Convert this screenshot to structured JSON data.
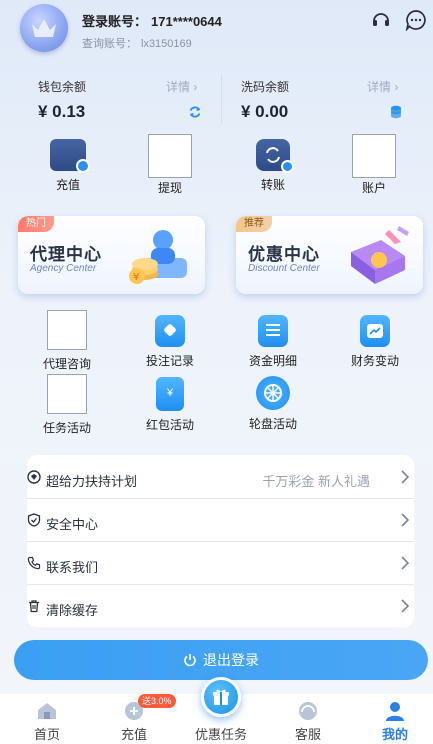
{
  "header": {
    "account_label": "登录账号：",
    "account_value": "171****0644",
    "query_label": "查询账号：",
    "query_value": "lx3150169",
    "icons": [
      "headset-icon",
      "chat-icon"
    ]
  },
  "wallet": {
    "balance_label": "钱包余额",
    "balance_detail": "详情",
    "balance_value": "¥ 0.13",
    "wash_label": "洗码余额",
    "wash_detail": "详情",
    "wash_value": "¥ 0.00"
  },
  "actions": {
    "deposit": "充值",
    "withdraw": "提现",
    "transfer": "转账",
    "account": "账户"
  },
  "banners": {
    "agency": {
      "tag": "热门",
      "title": "代理中心",
      "subtitle": "Agency Center"
    },
    "discount": {
      "tag": "推荐",
      "title": "优惠中心",
      "subtitle": "Discount Center"
    }
  },
  "features": {
    "agent_consult": "代理咨询",
    "bet_record": "投注记录",
    "fund_detail": "资金明细",
    "finance_change": "财务变动",
    "task_activity": "任务活动",
    "red_packet": "红包活动",
    "wheel": "轮盘活动"
  },
  "menu": {
    "support_plan": "超给力扶持计划",
    "support_extra": "千万彩金 新人礼遇",
    "security": "安全中心",
    "contact": "联系我们",
    "clear_cache": "清除缓存"
  },
  "logout_label": "退出登录",
  "tabbar": {
    "home": "首页",
    "recharge": "充值",
    "recharge_badge": "送3.0%",
    "promo": "优惠任务",
    "service": "客服",
    "mine": "我的"
  },
  "colors": {
    "accent": "#2b7fe0",
    "badge": "#ff5a3a"
  }
}
